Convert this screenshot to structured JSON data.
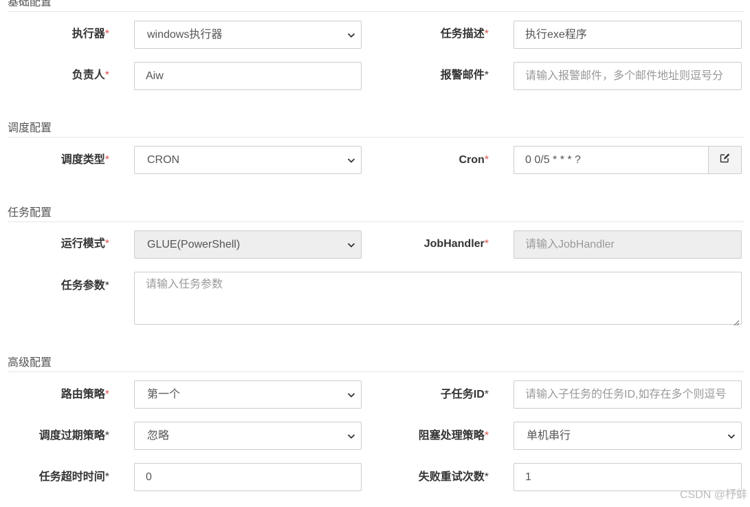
{
  "sections": {
    "basic": "基础配置",
    "schedule": "调度配置",
    "task": "任务配置",
    "advanced": "高级配置"
  },
  "fields": {
    "executor": {
      "label": "执行器",
      "value": "windows执行器"
    },
    "task_desc": {
      "label": "任务描述",
      "value": "执行exe程序"
    },
    "owner": {
      "label": "负责人",
      "value": "Aiw"
    },
    "alarm_email": {
      "label": "报警邮件",
      "placeholder": "请输入报警邮件，多个邮件地址则逗号分"
    },
    "schedule_type": {
      "label": "调度类型",
      "value": "CRON"
    },
    "cron": {
      "label": "Cron",
      "value": "0 0/5 * * * ?"
    },
    "run_mode": {
      "label": "运行模式",
      "value": "GLUE(PowerShell)"
    },
    "job_handler": {
      "label": "JobHandler",
      "placeholder": "请输入JobHandler"
    },
    "task_param": {
      "label": "任务参数",
      "placeholder": "请输入任务参数"
    },
    "route_strategy": {
      "label": "路由策略",
      "value": "第一个"
    },
    "child_job_id": {
      "label": "子任务ID",
      "placeholder": "请输入子任务的任务ID,如存在多个则逗号"
    },
    "misfire_strategy": {
      "label": "调度过期策略",
      "value": "忽略"
    },
    "block_strategy": {
      "label": "阻塞处理策略",
      "value": "单机串行"
    },
    "timeout": {
      "label": "任务超时时间",
      "value": "0"
    },
    "retry_count": {
      "label": "失败重试次数",
      "value": "1"
    }
  },
  "required_mark": "*",
  "watermark": "CSDN @杼蚌",
  "icons": {
    "select_arrow": "chevron-down-icon",
    "cron_edit": "edit-icon"
  }
}
